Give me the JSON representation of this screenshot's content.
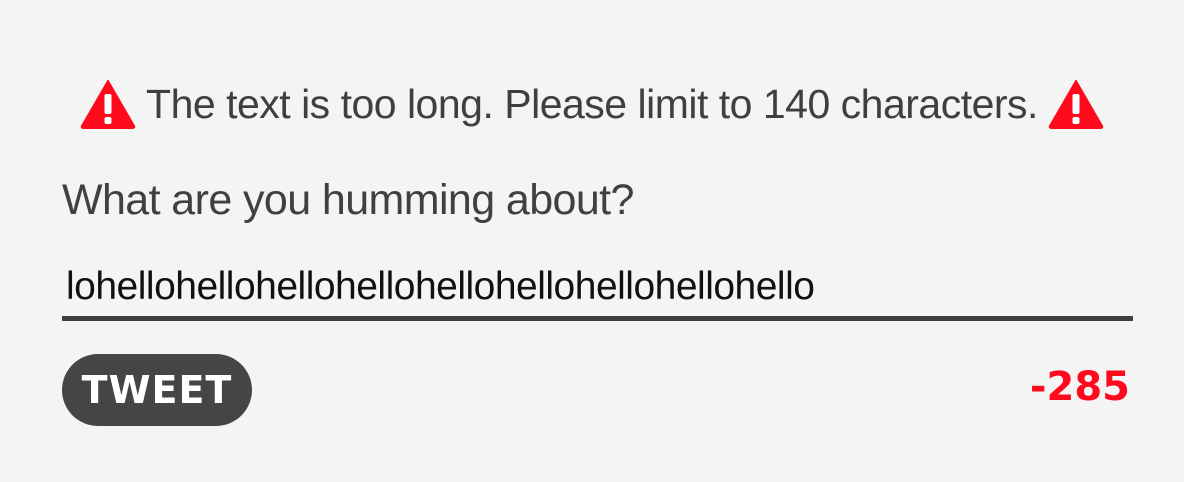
{
  "warning": {
    "icon": "warning-triangle-icon",
    "text": "The text is too long. Please limit to 140 characters.",
    "color": "#ff0a1d"
  },
  "compose": {
    "prompt": "What are you humming about?",
    "input_value": "lohellohellohellohellohellohellohellohellohello"
  },
  "tweet_button": {
    "label": "TWEET"
  },
  "char_counter": {
    "value": "-285",
    "color": "#ff0a1d"
  }
}
